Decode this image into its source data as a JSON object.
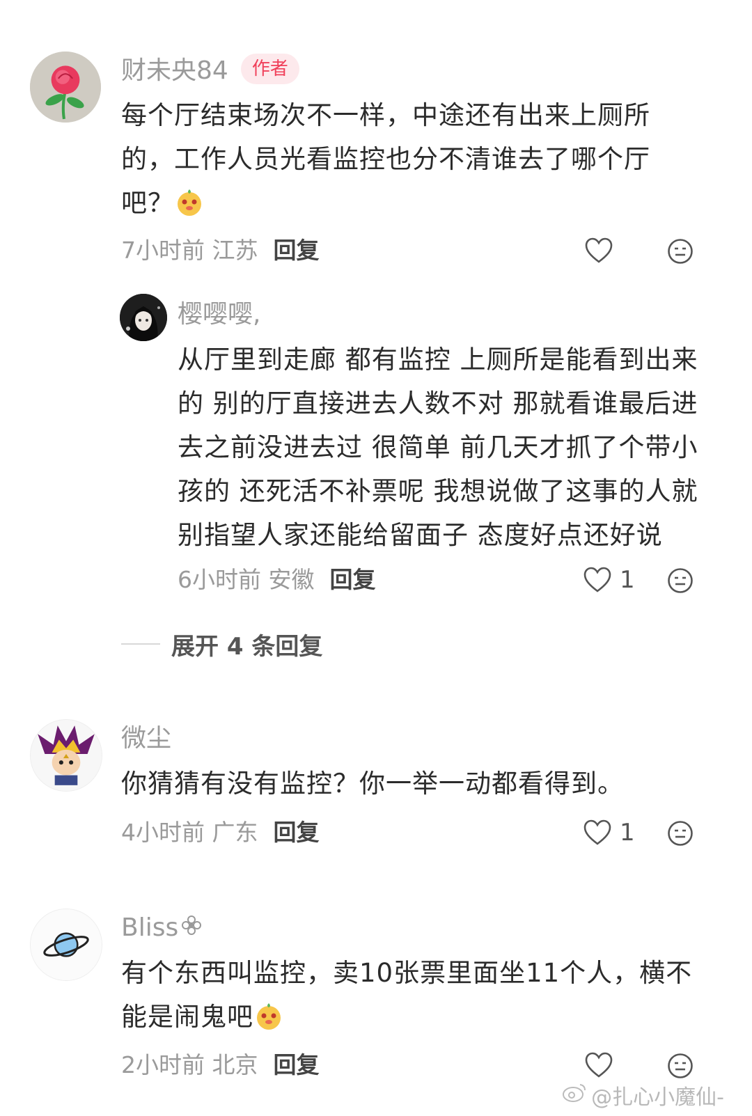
{
  "comments": [
    {
      "username": "财未央84",
      "badge": "作者",
      "text": "每个厅结束场次不一样，中途还有出来上厕所的，工作人员光看监控也分不清谁去了哪个厅吧？",
      "time": "7小时前",
      "location": "江苏",
      "reply_label": "回复",
      "avatar_icon": "rose-icon"
    },
    {
      "username": "樱嘤嘤,",
      "text": "从厅里到走廊 都有监控 上厕所是能看到出来的 别的厅直接进去人数不对 那就看谁最后进去之前没进去过 很简单 前几天才抓了个带小孩的 还死活不补票呢 我想说做了这事的人就别指望人家还能给留面子 态度好点还好说",
      "time": "6小时前",
      "location": "安徽",
      "reply_label": "回复",
      "likes": "1",
      "avatar_icon": "anime-girl-avatar"
    },
    {
      "username": "微尘",
      "text": "你猜猜有没有监控？你一举一动都看得到。",
      "time": "4小时前",
      "location": "广东",
      "reply_label": "回复",
      "likes": "1",
      "avatar_icon": "yugi-avatar"
    },
    {
      "username": "Bliss",
      "text": "有个东西叫监控，卖10张票里面坐11个人，横不能是闹鬼吧",
      "time": "2小时前",
      "location": "北京",
      "reply_label": "回复",
      "avatar_icon": "planet-icon"
    }
  ],
  "expand_replies": "展开 4 条回复",
  "watermark": "@扎心小魔仙-",
  "colors": {
    "badge_bg": "#fde9ec",
    "badge_text": "#f0405a",
    "meta": "#9a9a9a"
  }
}
